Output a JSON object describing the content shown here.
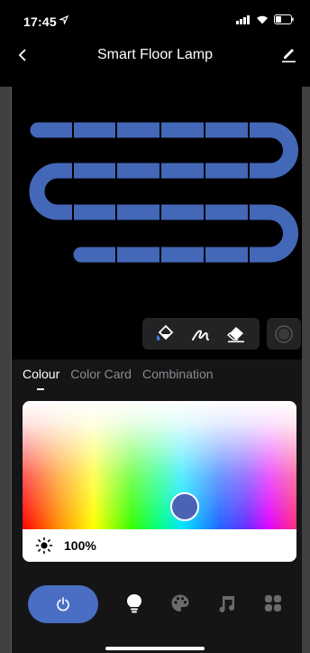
{
  "status_bar": {
    "time": "17:45"
  },
  "header": {
    "title": "Smart Floor Lamp"
  },
  "tabs": [
    {
      "label": "Colour",
      "active": true
    },
    {
      "label": "Color Card",
      "active": false
    },
    {
      "label": "Combination",
      "active": false
    }
  ],
  "color_picker": {
    "brightness": "100%",
    "selected_color": "#4a63b5"
  },
  "colors": {
    "accent": "#4a6ec3",
    "strip": "#4468b8",
    "panel": "#151517"
  },
  "toolbar": {
    "tools": [
      "paint-bucket-icon",
      "brush-icon",
      "eraser-icon"
    ]
  },
  "bottom_nav": {
    "items": [
      "power-icon",
      "bulb-icon",
      "palette-icon",
      "music-icon",
      "scene-grid-icon"
    ]
  }
}
